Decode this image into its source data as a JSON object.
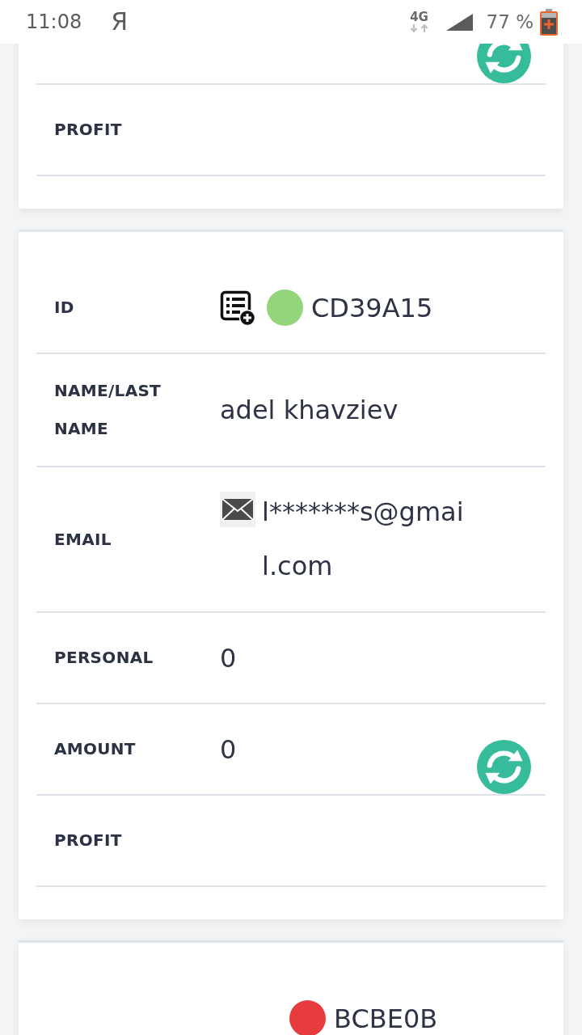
{
  "status_bar": {
    "time": "11:08",
    "notification": "Я",
    "network": "4G",
    "battery": "77 %"
  },
  "cards": [
    {
      "rows": [
        {
          "kind": "text",
          "refresh": true
        },
        {
          "kind": "text",
          "label": "PROFIT",
          "refresh": false
        }
      ]
    },
    {
      "rows": [
        {
          "kind": "id",
          "label": "ID",
          "list_icon": true,
          "color": "#94d47a",
          "value": "CD39A15",
          "refresh": false
        },
        {
          "kind": "text",
          "label": "NAME/LAST NAME",
          "value": "adel khavziev",
          "refresh": false
        },
        {
          "kind": "email",
          "label": "EMAIL",
          "value": "l*******s@gmail.com",
          "refresh": false
        },
        {
          "kind": "text",
          "label": "PERSONAL",
          "value": "0",
          "refresh": false
        },
        {
          "kind": "text",
          "label": "AMOUNT",
          "value": "0",
          "refresh": true
        },
        {
          "kind": "text",
          "label": "PROFIT",
          "refresh": false
        }
      ]
    },
    {
      "rows": [
        {
          "kind": "id",
          "list_icon": false,
          "color": "#e83b3e",
          "value": "BCBE0B",
          "refresh": false
        }
      ]
    }
  ]
}
